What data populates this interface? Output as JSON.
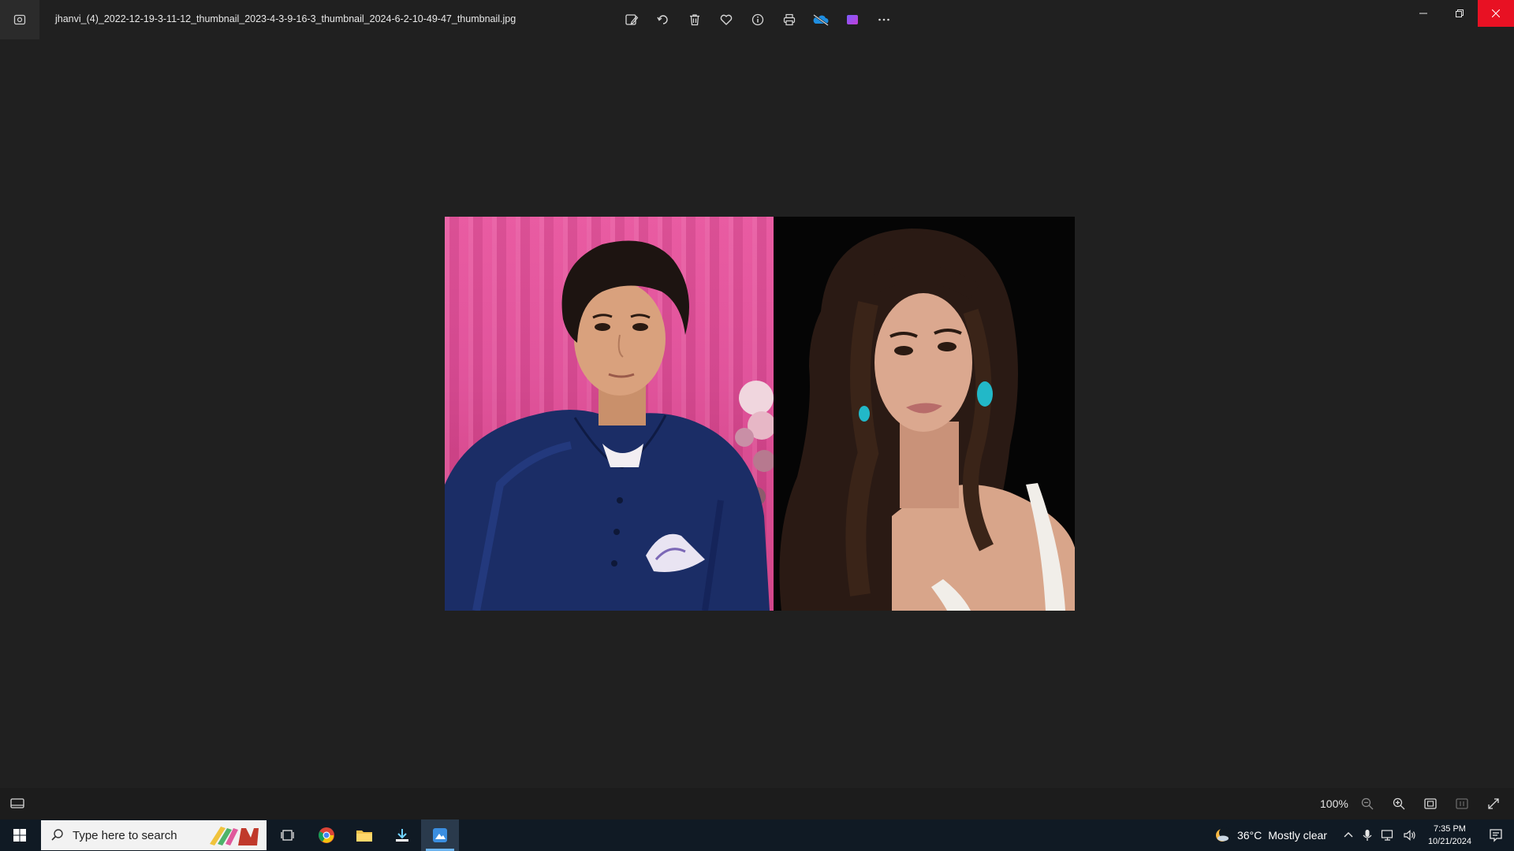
{
  "window": {
    "filename": "jhanvi_(4)_2022-12-19-3-11-12_thumbnail_2023-4-3-9-16-3_thumbnail_2024-6-2-10-49-47_thumbnail.jpg",
    "toolbar_icons": [
      "edit-image-icon",
      "rotate-icon",
      "delete-icon",
      "favorite-icon",
      "info-icon",
      "print-icon",
      "onedrive-icon",
      "clipchamp-icon",
      "more-icon"
    ],
    "controls": [
      "minimize",
      "restore",
      "close"
    ],
    "accent_close": "#e81123"
  },
  "viewer": {
    "zoom": "100%",
    "tools": [
      "zoom-out-icon",
      "zoom-in-icon",
      "fit-window-icon",
      "actual-size-icon",
      "fullscreen-icon"
    ]
  },
  "taskbar": {
    "search_placeholder": "Type here to search",
    "apps": [
      "task-view",
      "chrome",
      "file-explorer",
      "downloads",
      "photos-active"
    ],
    "weather": {
      "temp": "36°C",
      "condition": "Mostly clear"
    },
    "clock": {
      "time": "7:35 PM",
      "date": "10/21/2024"
    }
  }
}
